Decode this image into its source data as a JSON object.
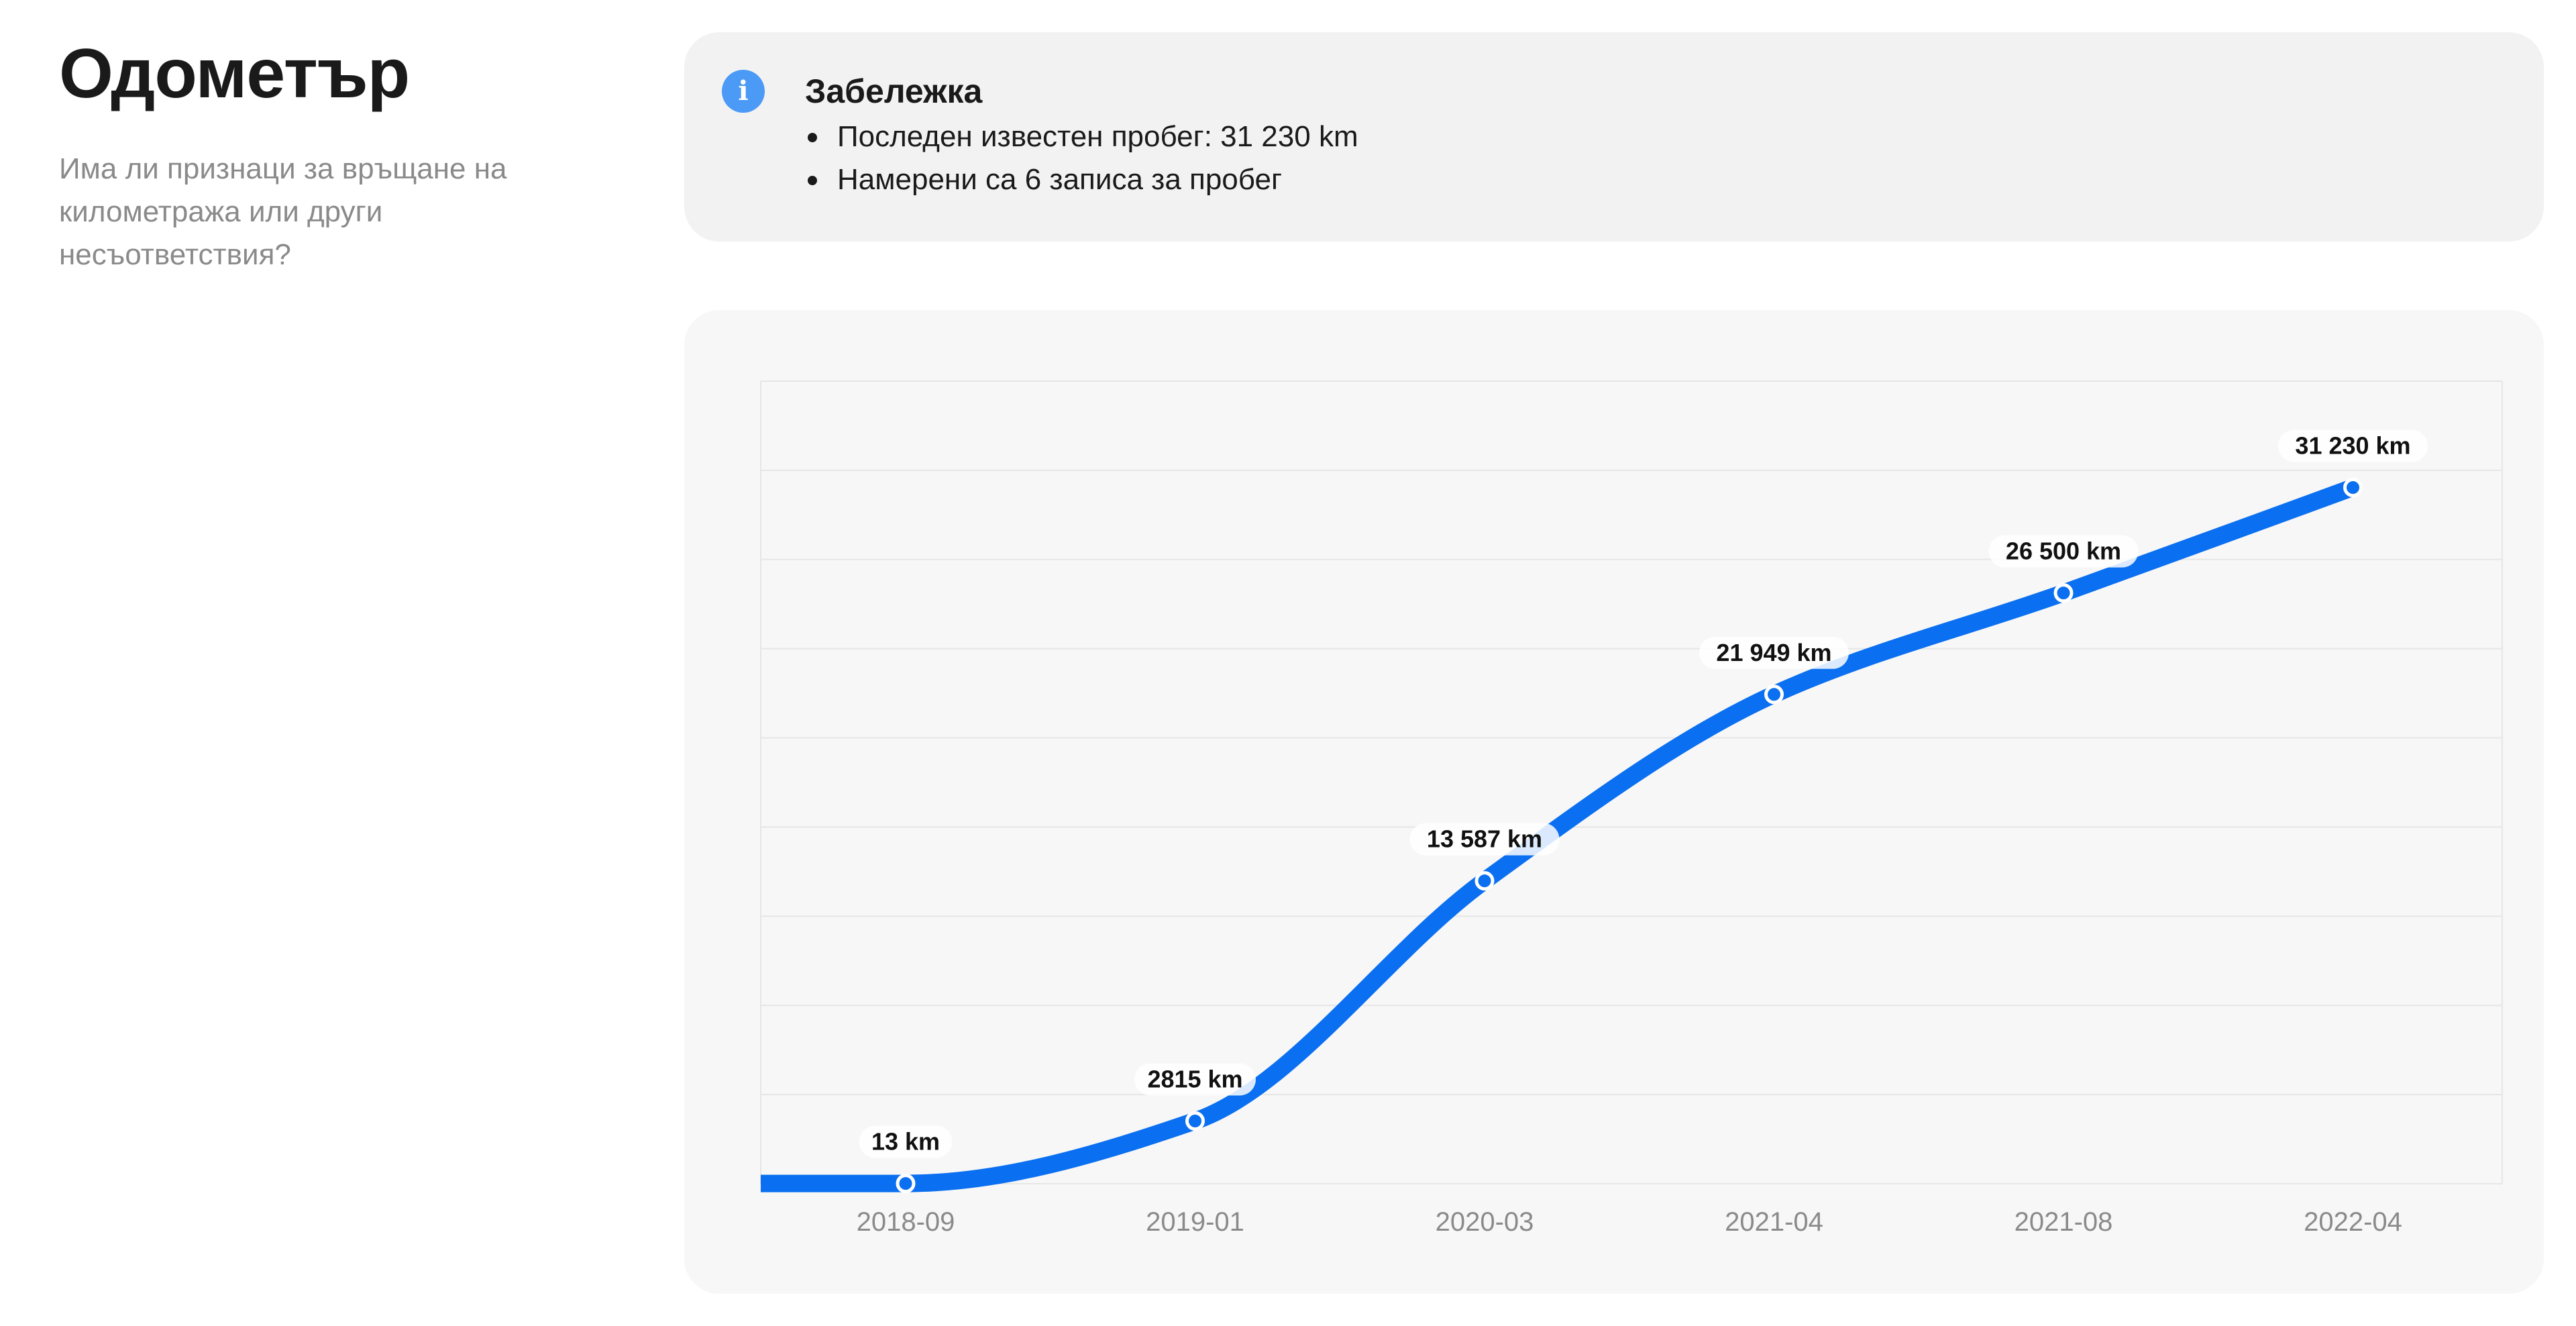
{
  "header": {
    "title": "Одометър",
    "subtitle": "Има ли признаци за връщане на километража или други несъответствия?"
  },
  "note": {
    "icon": "info-icon",
    "icon_glyph": "i",
    "title": "Забележка",
    "items": [
      "Последен известен пробег: 31 230 km",
      "Намерени са 6 записа за пробег"
    ]
  },
  "colors": {
    "accent": "#0a6ff0",
    "info": "#4b9af6",
    "note_bg": "#f2f2f2",
    "chart_bg": "#f7f7f7"
  },
  "chart_data": {
    "type": "line",
    "title": "",
    "xlabel": "",
    "ylabel": "",
    "categories": [
      "2018-09",
      "2019-01",
      "2020-03",
      "2021-04",
      "2021-08",
      "2022-04"
    ],
    "values": [
      13,
      2815,
      13587,
      21949,
      26500,
      31230
    ],
    "labels": [
      "13 km",
      "2815 km",
      "13 587 km",
      "21 949 km",
      "26 500 km",
      "31 230 km"
    ],
    "unit": "km",
    "ylim": [
      0,
      36000
    ],
    "grid": true,
    "curve": "smooth",
    "line_color": "#0a6ff0"
  }
}
